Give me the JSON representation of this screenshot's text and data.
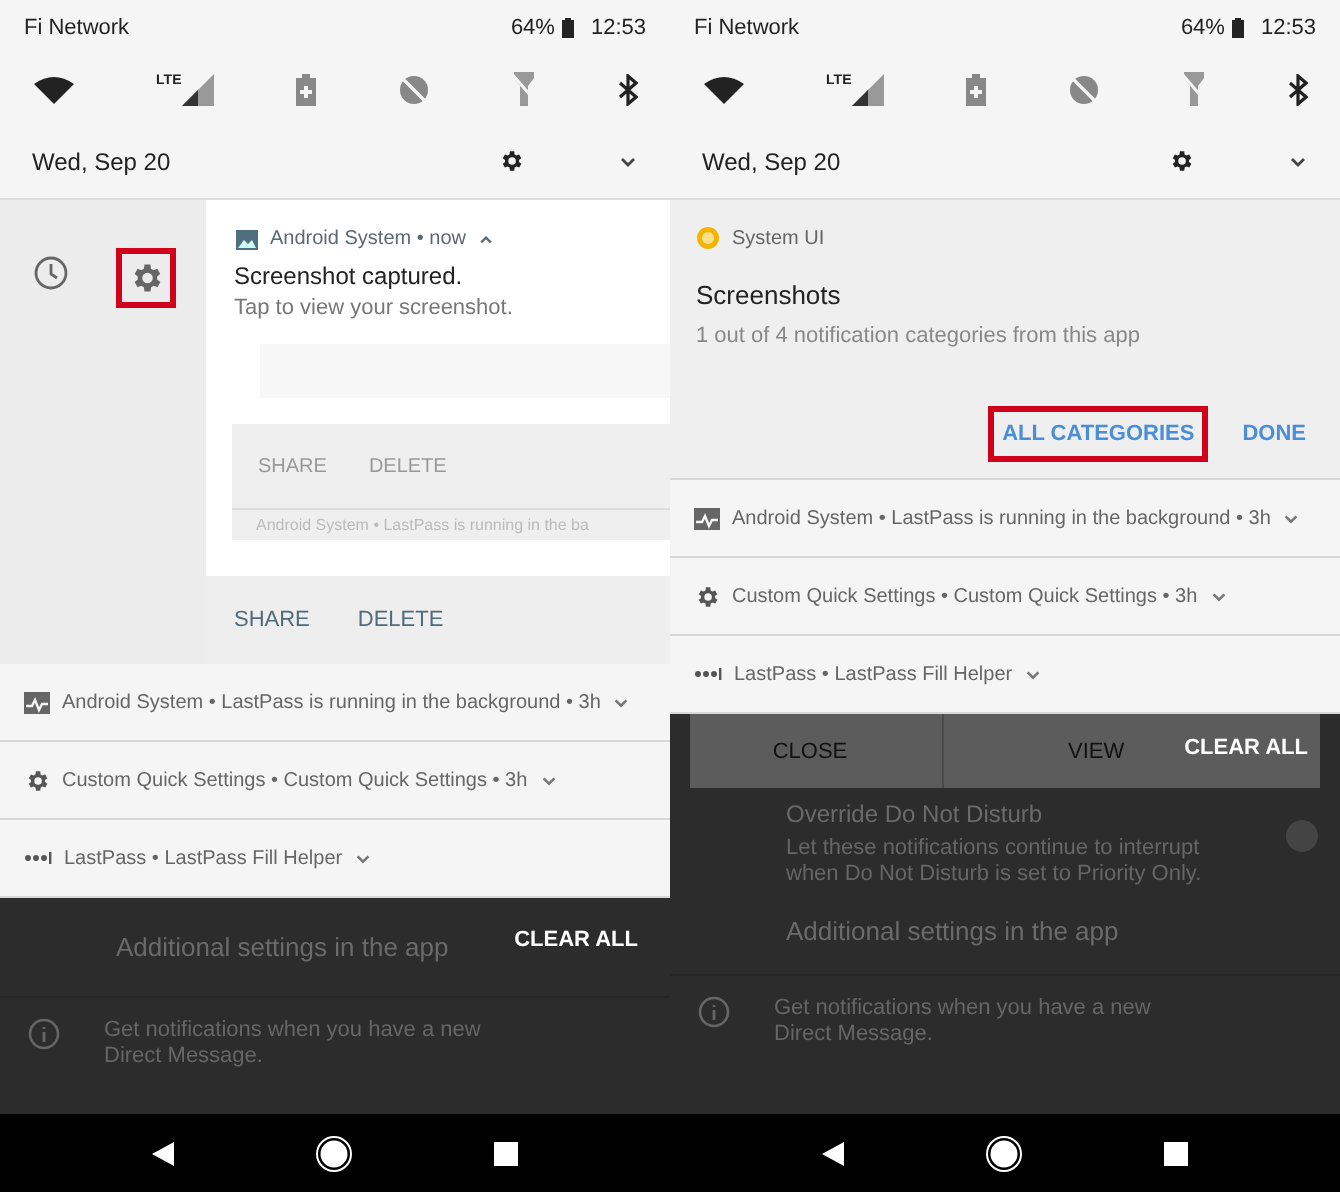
{
  "screens": [
    {
      "kind": "snooze",
      "status_bar": {
        "carrier": "Fi Network",
        "battery": "64%",
        "time": "12:53"
      },
      "network_label": "LTE",
      "date": "Wed, Sep 20",
      "notification": {
        "gear_highlighted": true,
        "header": "Android System • now",
        "title": "Screenshot captured.",
        "text": "Tap to view your screenshot.",
        "preview_actions": [
          "SHARE",
          "DELETE"
        ],
        "preview_text": "Android System • LastPass is running in the ba",
        "actions": [
          "SHARE",
          "DELETE"
        ]
      },
      "notifications": [
        {
          "kind": "activity",
          "text": "Android System • LastPass is running in the background • 3h"
        },
        {
          "kind": "gear",
          "text": "Custom Quick Settings • Custom Quick Settings • 3h"
        },
        {
          "kind": "dots",
          "text": "LastPass • LastPass Fill Helper"
        }
      ],
      "clear_all": "CLEAR ALL",
      "background": {
        "heading": "Additional settings in the app",
        "info": "Get notifications when you have a new Direct Message."
      }
    },
    {
      "kind": "settings",
      "status_bar": {
        "carrier": "Fi Network",
        "battery": "64%",
        "time": "12:53"
      },
      "network_label": "LTE",
      "date": "Wed, Sep 20",
      "settings_card": {
        "app": "System UI",
        "title": "Screenshots",
        "text": "1 out of 4 notification categories from this app",
        "buttons": [
          {
            "label": "ALL CATEGORIES",
            "highlighted": true
          },
          {
            "label": "DONE",
            "highlighted": false
          }
        ]
      },
      "notifications": [
        {
          "kind": "activity",
          "text": "Android System • LastPass is running in the background • 3h"
        },
        {
          "kind": "gear",
          "text": "Custom Quick Settings • Custom Quick Settings • 3h"
        },
        {
          "kind": "dots",
          "text": "LastPass • LastPass Fill Helper"
        }
      ],
      "dialog_buttons": [
        "CLOSE",
        "VIEW"
      ],
      "clear_all": "CLEAR ALL",
      "background": {
        "override_heading": "Override Do Not Disturb",
        "override_text": "Let these notifications continue to interrupt when Do Not Disturb is set to Priority Only.",
        "override_on": false,
        "heading": "Additional settings in the app",
        "info": "Get notifications when you have a new Direct Message."
      }
    }
  ]
}
